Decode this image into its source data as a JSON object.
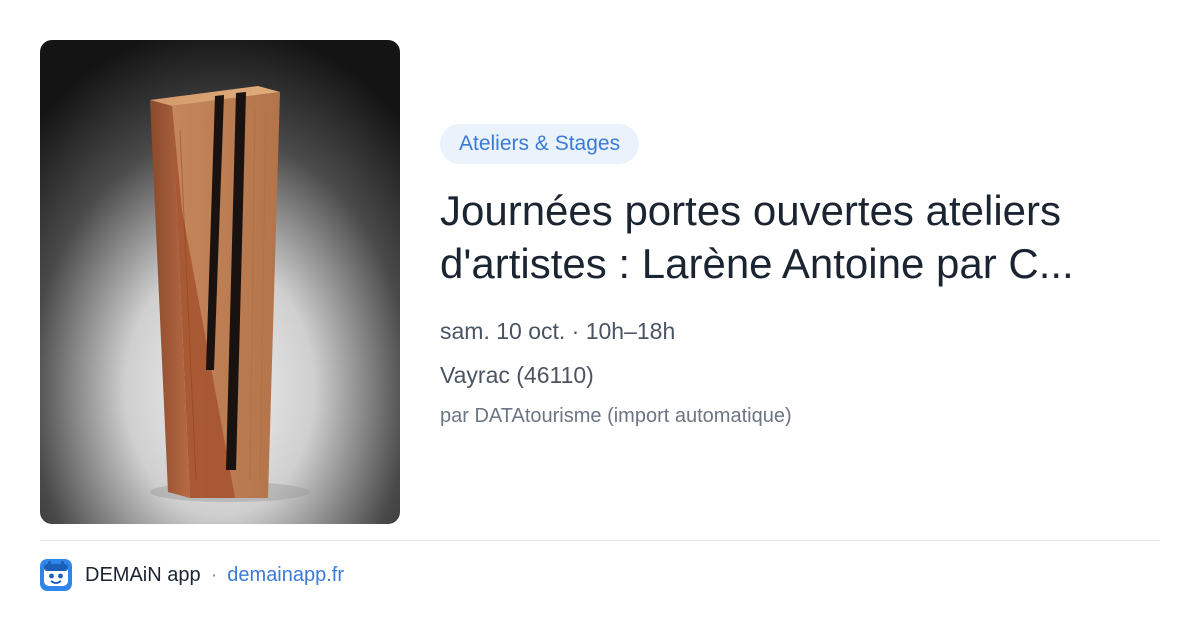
{
  "image": {
    "icon": "wooden-sculpture-image"
  },
  "event": {
    "category": "Ateliers & Stages",
    "title_line1": "Journées portes ouvertes ateliers",
    "title_line2": "d'artistes : Larène Antoine par C...",
    "datetime": "sam. 10 oct. · 10h–18h",
    "location": "Vayrac (46110)",
    "source": "par DATAtourisme (import automatique)"
  },
  "footer": {
    "app_icon": "demain-app-logo-icon",
    "app_name": "DEMAiN app",
    "separator": "·",
    "link_text": "demainapp.fr"
  },
  "colors": {
    "accent": "#3a7bd5",
    "pill_background": "#eaf2fc",
    "title_text": "#1b2431"
  }
}
